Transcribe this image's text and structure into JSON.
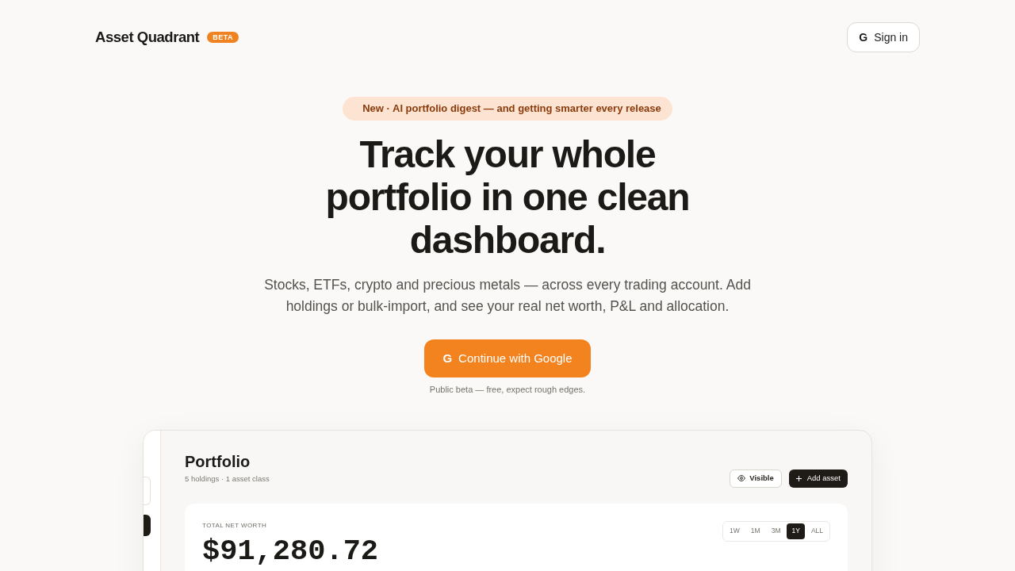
{
  "header": {
    "logo": "Asset Quadrant",
    "badge": "BETA",
    "sign_in_button": {
      "icon_letter": "G",
      "label": "Sign in"
    }
  },
  "hero": {
    "announcement": "New · AI portfolio digest — and getting smarter every release",
    "headline": "Track your whole portfolio in one clean dashboard.",
    "description": "Stocks, ETFs, crypto and precious metals — across every trading account. Add holdings or bulk-import, and see your real net worth, P&L and allocation.",
    "cta_button": {
      "icon_letter": "G",
      "label": "Continue with Google"
    },
    "note": "Public beta — free, expect rough edges."
  },
  "preview": {
    "sidebar": {
      "items": [
        {
          "selected": false
        },
        {
          "selected": true
        }
      ]
    },
    "title": "Portfolio",
    "subtitle": "5 holdings · 1 asset class",
    "buttons": [
      {
        "kind": "outline",
        "label": "Visible"
      },
      {
        "kind": "primary",
        "label": "Add asset"
      }
    ],
    "net_worth": {
      "label": "TOTAL NET WORTH",
      "value": "$91,280.72",
      "ranges": [
        {
          "label": "1W",
          "selected": false
        },
        {
          "label": "1M",
          "selected": false
        },
        {
          "label": "3M",
          "selected": false
        },
        {
          "label": "1Y",
          "selected": true
        },
        {
          "label": "ALL",
          "selected": false
        }
      ]
    }
  }
}
